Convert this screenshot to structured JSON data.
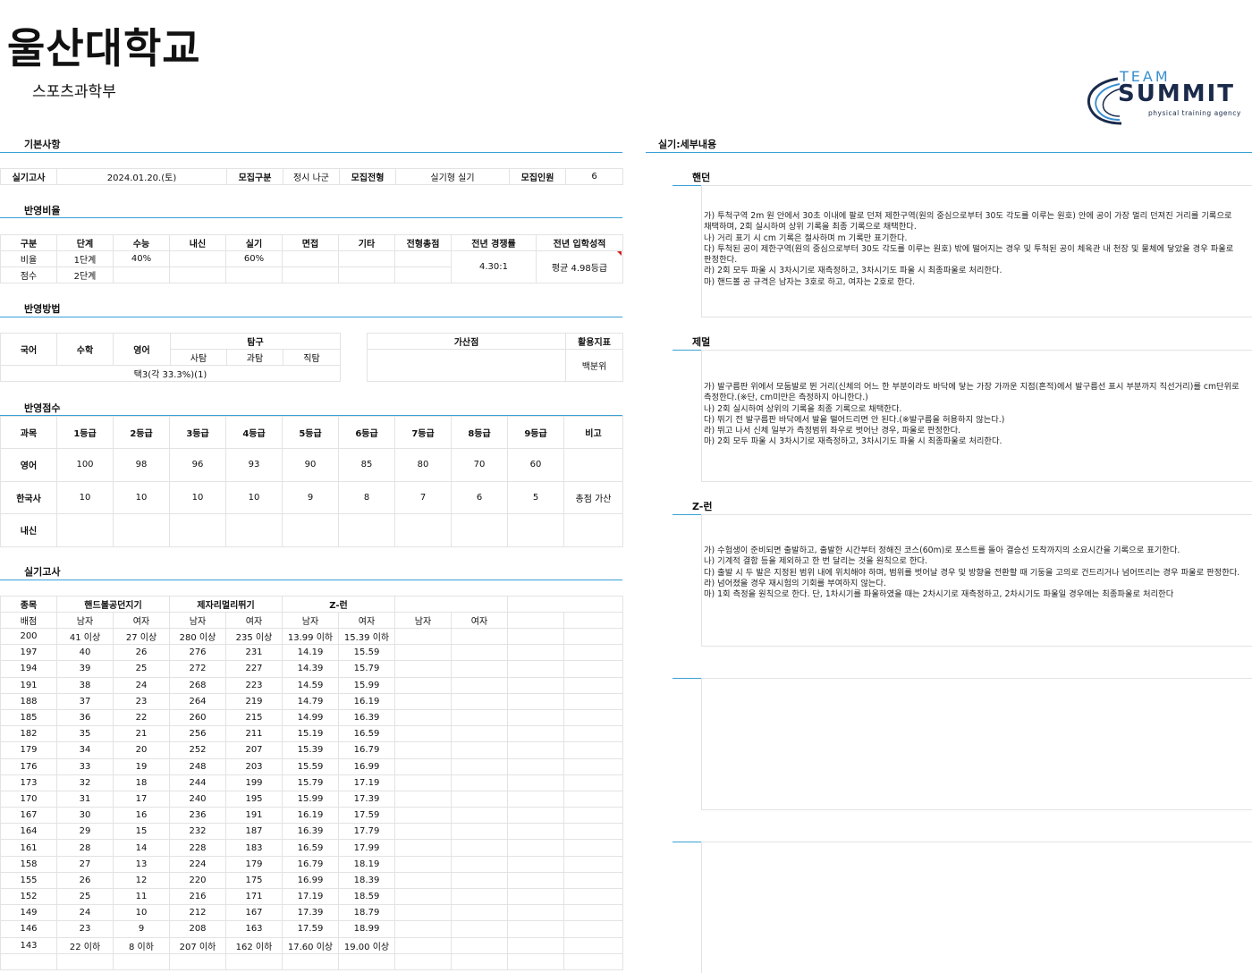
{
  "header": {
    "university": "울산대학교",
    "department": "스포츠과학부"
  },
  "logo": {
    "team": "TEAM",
    "summit": "SUMMIT",
    "tagline": "physical training agency"
  },
  "sections": {
    "basic": "기본사항",
    "ratio": "반영비율",
    "method": "반영방법",
    "score": "반영점수",
    "practical": "실기고사",
    "detail": "실기:세부내용"
  },
  "basic_info": {
    "exam_label": "실기고사",
    "exam_date": "2024.01.20.(토)",
    "group_label": "모집구분",
    "group_value": "정시 나군",
    "type_label": "모집전형",
    "type_value": "실기형 실기",
    "count_label": "모집인원",
    "count_value": "6"
  },
  "ratio_table": {
    "headers": [
      "구분",
      "단계",
      "수능",
      "내신",
      "실기",
      "면접",
      "기타",
      "전형총점",
      "전년 경쟁률",
      "전년 입학성적"
    ],
    "row1": [
      "비율",
      "1단계",
      "40%",
      "",
      "60%",
      "",
      "",
      ""
    ],
    "row2": [
      "점수",
      "2단계",
      "",
      "",
      "",
      "",
      "",
      ""
    ],
    "competition": "4.30:1",
    "admission": "평균 4.98등급"
  },
  "method_table": {
    "korean": "국어",
    "math": "수학",
    "english": "영어",
    "inquiry": "탐구",
    "social": "사탐",
    "science": "과탐",
    "vocational": "직탐",
    "selection": "택3(각 33.3%)(1)",
    "bonus": "가산점",
    "indicator": "활용지표",
    "indicator_value": "백분위"
  },
  "score_table": {
    "headers": [
      "과목",
      "1등급",
      "2등급",
      "3등급",
      "4등급",
      "5등급",
      "6등급",
      "7등급",
      "8등급",
      "9등급",
      "비고"
    ],
    "rows": [
      [
        "영어",
        "100",
        "98",
        "96",
        "93",
        "90",
        "85",
        "80",
        "70",
        "60",
        ""
      ],
      [
        "한국사",
        "10",
        "10",
        "10",
        "10",
        "9",
        "8",
        "7",
        "6",
        "5",
        "총점 가산"
      ],
      [
        "내신",
        "",
        "",
        "",
        "",
        "",
        "",
        "",
        "",
        "",
        ""
      ]
    ]
  },
  "practical_table": {
    "event_label": "종목",
    "events": [
      "핸드볼공던지기",
      "제자리멀리뛰기",
      "Z-런"
    ],
    "score_label": "배점",
    "male": "남자",
    "female": "여자",
    "rows": [
      [
        "200",
        "41 이상",
        "27 이상",
        "280 이상",
        "235 이상",
        "13.99 이하",
        "15.39 이하"
      ],
      [
        "197",
        "40",
        "26",
        "276",
        "231",
        "14.19",
        "15.59"
      ],
      [
        "194",
        "39",
        "25",
        "272",
        "227",
        "14.39",
        "15.79"
      ],
      [
        "191",
        "38",
        "24",
        "268",
        "223",
        "14.59",
        "15.99"
      ],
      [
        "188",
        "37",
        "23",
        "264",
        "219",
        "14.79",
        "16.19"
      ],
      [
        "185",
        "36",
        "22",
        "260",
        "215",
        "14.99",
        "16.39"
      ],
      [
        "182",
        "35",
        "21",
        "256",
        "211",
        "15.19",
        "16.59"
      ],
      [
        "179",
        "34",
        "20",
        "252",
        "207",
        "15.39",
        "16.79"
      ],
      [
        "176",
        "33",
        "19",
        "248",
        "203",
        "15.59",
        "16.99"
      ],
      [
        "173",
        "32",
        "18",
        "244",
        "199",
        "15.79",
        "17.19"
      ],
      [
        "170",
        "31",
        "17",
        "240",
        "195",
        "15.99",
        "17.39"
      ],
      [
        "167",
        "30",
        "16",
        "236",
        "191",
        "16.19",
        "17.59"
      ],
      [
        "164",
        "29",
        "15",
        "232",
        "187",
        "16.39",
        "17.79"
      ],
      [
        "161",
        "28",
        "14",
        "228",
        "183",
        "16.59",
        "17.99"
      ],
      [
        "158",
        "27",
        "13",
        "224",
        "179",
        "16.79",
        "18.19"
      ],
      [
        "155",
        "26",
        "12",
        "220",
        "175",
        "16.99",
        "18.39"
      ],
      [
        "152",
        "25",
        "11",
        "216",
        "171",
        "17.19",
        "18.59"
      ],
      [
        "149",
        "24",
        "10",
        "212",
        "167",
        "17.39",
        "18.79"
      ],
      [
        "146",
        "23",
        "9",
        "208",
        "163",
        "17.59",
        "18.99"
      ],
      [
        "143",
        "22 이하",
        "8 이하",
        "207 이하",
        "162 이하",
        "17.60 이상",
        "19.00 이상"
      ]
    ]
  },
  "details": [
    {
      "title": "핸던",
      "text": "가) 투척구역 2m 원 안에서 30초 이내에 팔로 던져 제한구역(원의 중심으로부터 30도 각도를 이루는 원호) 안에 공이 가장 멀리 던져진 거리를 기록으로 채택하며, 2회 실시하여 상위 기록을 최종 기록으로 채택한다.\n나) 거리 표기 시 cm 기록은 절사하며 m 기록만 표기한다.\n다) 투척된 공이 제한구역(원의 중심으로부터 30도 각도를 이루는 원호) 밖에 떨어지는 경우 및 투척된 공이 체육관 내 천장 및 물체에 닿았을 경우 파울로 판정한다.\n라) 2회 모두 파울 시 3차시기로 재측정하고, 3차시기도 파울 시 최종파울로 처리한다.\n마) 핸드볼 공 규격은 남자는 3호로 하고, 여자는 2호로 한다."
    },
    {
      "title": "제멀",
      "text": "가) 발구름판 위에서 모둠발로 뛴 거리(신체의 어느 한 부분이라도 바닥에 닿는 가장 가까운 지점(흔적)에서 발구름선 표시 부분까지 직선거리)를 cm단위로 측정한다.(※단, cm미만은 측정하지 아니한다.)\n나) 2회 실시하여 상위의 기록을 최종 기록으로 채택한다.\n다) 뛰기 전 발구름판 바닥에서 발을 떨어드리면 안 된다.(※발구름을 허용하지 않는다.)\n라) 뛰고 나서 신체 일부가 측정범위 좌우로 벗어난 경우, 파울로 판정한다.\n마) 2회 모두 파울 시 3차시기로 재측정하고, 3차시기도 파울 시 최종파울로 처리한다."
    },
    {
      "title": "Z-런",
      "text": "가) 수험생이 준비되면 출발하고, 출발한 시간부터 정해진 코스(60m)로 포스트를 돌아 결승선 도착까지의 소요시간을 기록으로 표기한다.\n나) 기계적 결함 등을 제외하고 한 번 달리는 것을 원칙으로 한다.\n다) 출발 시 두 발은 지정된 범위 내에 위치해야 하며, 범위를 벗어날 경우 및 방향을 전환할 때 기둥을 고의로 건드리거나 넘어뜨리는 경우 파울로 판정한다.\n라) 넘어졌을 경우 재시험의 기회를 부여하지 않는다.\n마) 1회 측정을 원칙으로 한다. 단, 1차시기를 파울하였을 때는 2차시기로 재측정하고, 2차시기도 파울일 경우에는 최종파울로 처리한다"
    }
  ]
}
